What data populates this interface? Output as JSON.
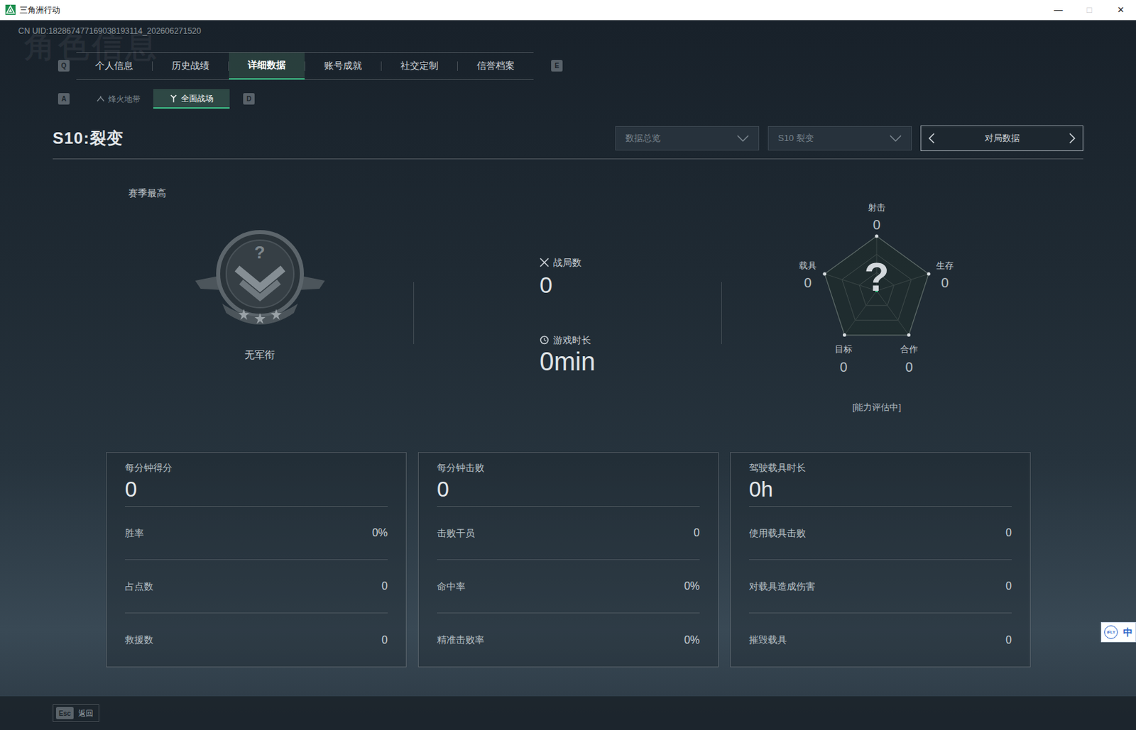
{
  "window": {
    "title": "三角洲行动",
    "controls": [
      {
        "label": "—",
        "disabled": false
      },
      {
        "label": "□",
        "disabled": true
      },
      {
        "label": "✕",
        "disabled": false
      }
    ]
  },
  "uid": "CN UID:182867477169038193114_202606271520",
  "watermark": "角色信息",
  "tabs": {
    "prev_key": "Q",
    "next_key": "E",
    "items": [
      {
        "label": "个人信息",
        "selected": false
      },
      {
        "label": "历史战绩",
        "selected": false
      },
      {
        "label": "详细数据",
        "selected": true
      },
      {
        "label": "账号成就",
        "selected": false
      },
      {
        "label": "社交定制",
        "selected": false
      },
      {
        "label": "信誉档案",
        "selected": false
      }
    ]
  },
  "subtabs": {
    "prev_key": "A",
    "next_key": "D",
    "items": [
      {
        "label": "烽火地带",
        "selected": false
      },
      {
        "label": "全面战场",
        "selected": true
      }
    ]
  },
  "season_title": "S10:裂变",
  "filters": {
    "view": "数据总览",
    "season": "S10 裂变",
    "mode": "对局数据"
  },
  "rank": {
    "label": "赛季最高",
    "emblem_mark": "?",
    "name": "无军衔"
  },
  "summary": {
    "matches": {
      "label": "战局数",
      "value": "0"
    },
    "playtime": {
      "label": "游戏时长",
      "value": "0min"
    }
  },
  "radar": {
    "center_mark": "?",
    "status": "[能力评估中]",
    "axes": [
      {
        "label": "射击",
        "value": "0",
        "level": 0
      },
      {
        "label": "生存",
        "value": "0",
        "level": 0
      },
      {
        "label": "合作",
        "value": "0",
        "level": 0
      },
      {
        "label": "目标",
        "value": "0",
        "level": 0
      },
      {
        "label": "载具",
        "value": "0",
        "level": 0
      }
    ]
  },
  "cards": [
    {
      "title": "每分钟得分",
      "value": "0",
      "rows": [
        {
          "label": "胜率",
          "value": "0%"
        },
        {
          "label": "占点数",
          "value": "0"
        },
        {
          "label": "救援数",
          "value": "0"
        }
      ]
    },
    {
      "title": "每分钟击败",
      "value": "0",
      "rows": [
        {
          "label": "击败干员",
          "value": "0"
        },
        {
          "label": "命中率",
          "value": "0%"
        },
        {
          "label": "精准击败率",
          "value": "0%"
        }
      ]
    },
    {
      "title": "驾驶载具时长",
      "value": "0h",
      "rows": [
        {
          "label": "使用载具击败",
          "value": "0"
        },
        {
          "label": "对载具造成伤害",
          "value": "0"
        },
        {
          "label": "摧毁载具",
          "value": "0"
        }
      ]
    }
  ],
  "footer": {
    "key": "Esc",
    "label": "返回"
  },
  "ime": {
    "logo": "iFLY",
    "mode": "中"
  }
}
